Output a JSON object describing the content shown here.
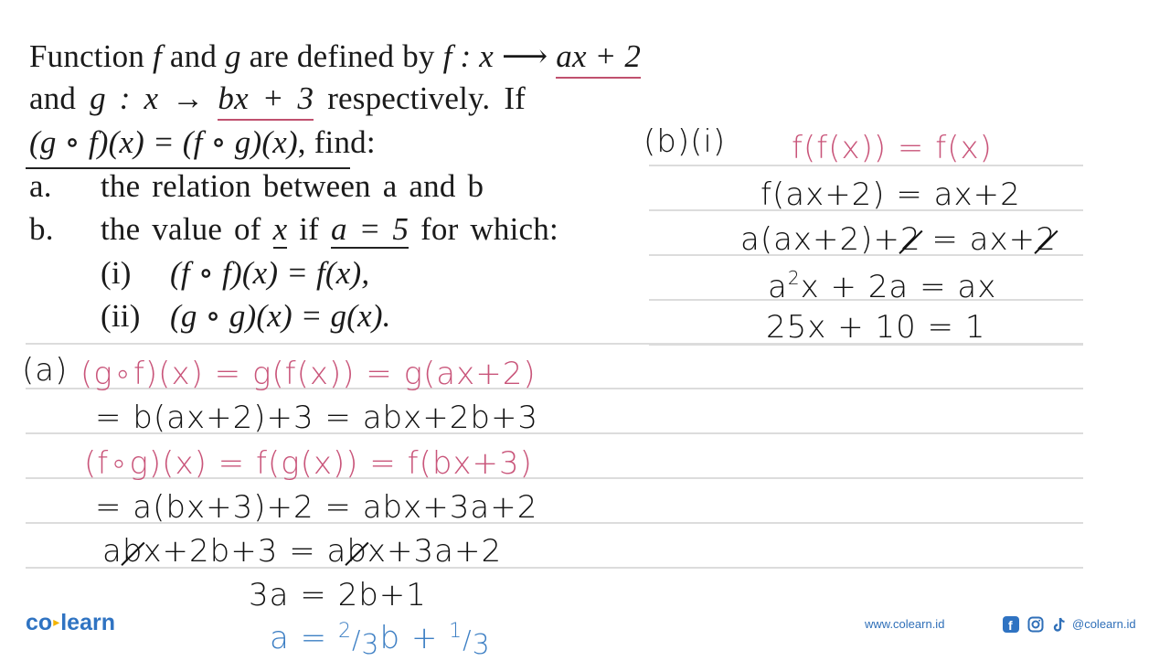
{
  "question": {
    "line1": {
      "prefix": "Function ",
      "f": "f",
      "mid1": " and ",
      "g": "g",
      "mid2": " are defined by ",
      "f2": "f",
      "map": " : x ⟶ ",
      "expr": "ax + 2"
    },
    "line2": {
      "prefix": "and  ",
      "g": "g",
      "map": " : x → ",
      "expr": "bx + 3",
      "suffix": " respectively. If"
    },
    "line3": {
      "expr": "(g ∘ f)(x) = (f ∘ g)(x)",
      "suffix": ", find:"
    },
    "item_a": {
      "label": "a.",
      "text": "the relation between a and b"
    },
    "item_b": {
      "label": "b.",
      "text_pre": "the value of ",
      "x": "x",
      "mid": " if ",
      "cond": "a = 5",
      "suffix": " for which:"
    },
    "item_b_i": {
      "label": "(i)",
      "text": "(f ∘ f)(x) = f(x),"
    },
    "item_b_ii": {
      "label": "(ii)",
      "text": "(g ∘ g)(x) = g(x)."
    }
  },
  "solution_a": {
    "label": "(a)",
    "line1": "(g∘f)(x) = g(f(x)) = g(ax+2)",
    "line2": "= b(ax+2)+3 = abx+2b+3",
    "line3": "(f∘g)(x) = f(g(x)) = f(bx+3)",
    "line4": "= a(bx+3)+2 = abx+3a+2",
    "line5": {
      "a1": "a",
      "b1": "b",
      "rest1": "x+2b+3 = ",
      "a2": "a",
      "b2": "b",
      "rest2": "x+3a+2"
    },
    "line6": "3a = 2b+1",
    "line7": {
      "lhs": "a = ",
      "n1": "2",
      "d1": "3",
      "mid": "b + ",
      "n2": "1",
      "d2": "3"
    }
  },
  "solution_b": {
    "label": "(b)(i)",
    "line1": "f(f(x)) = f(x)",
    "line2": "f(ax+2) = ax+2",
    "line3": {
      "pre": "a(ax+2)+",
      "s1": "2",
      "mid": " = ax+",
      "s2": "2"
    },
    "line4": {
      "a": "a",
      "sup": "2",
      "rest": "x + 2a = ax"
    },
    "line5": "25x + 10 = 1"
  },
  "branding": {
    "logo_left": "co",
    "logo_right": "learn",
    "website": "www.colearn.id",
    "handle": "@colearn.id",
    "social_icons": [
      "facebook-icon",
      "instagram-icon",
      "tiktok-icon"
    ]
  },
  "colors": {
    "pink_ink": "#c9557a",
    "black_ink": "#111111",
    "blue_ink": "#3d7fc4",
    "brand_blue": "#2f73c2",
    "rule_gray": "#dcdcdc"
  }
}
